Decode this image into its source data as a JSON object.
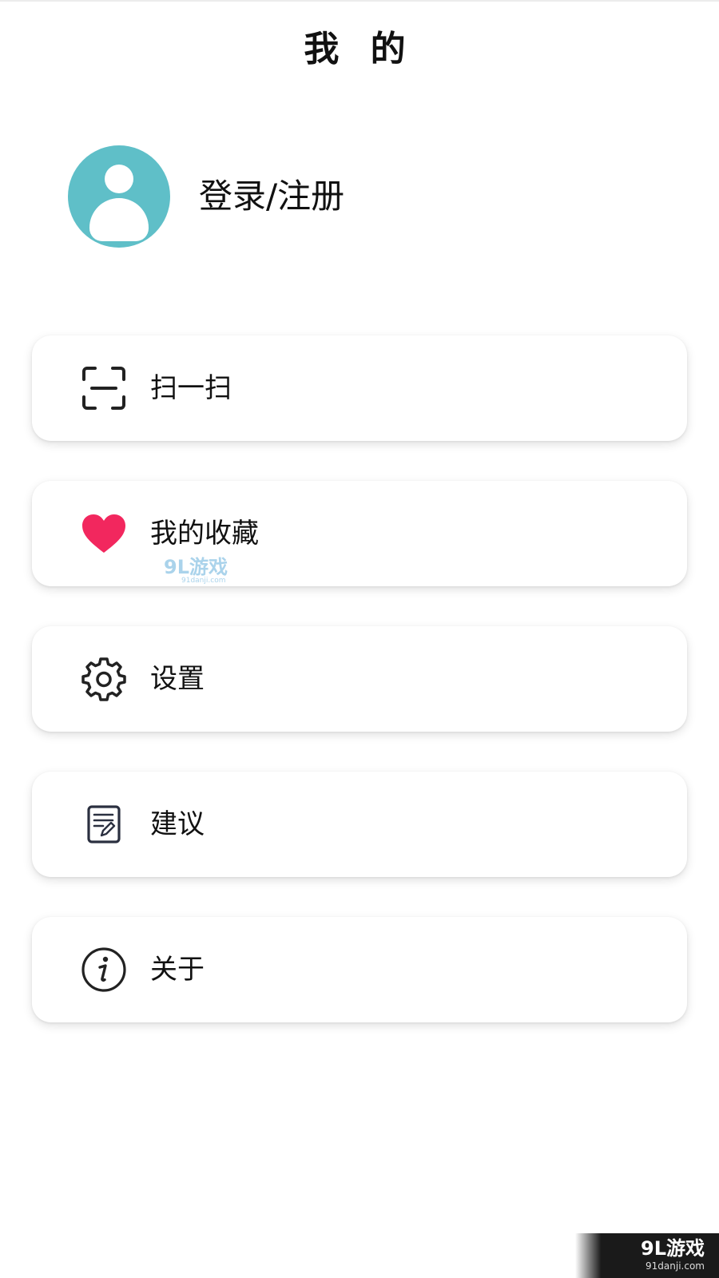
{
  "header": {
    "title": "我 的"
  },
  "profile": {
    "avatar_icon": "user-avatar-icon",
    "avatar_color": "#5fbfc8",
    "login_label": "登录/注册"
  },
  "menu": {
    "items": [
      {
        "label": "扫一扫",
        "icon": "scan-icon"
      },
      {
        "label": "我的收藏",
        "icon": "heart-icon",
        "icon_color": "#f2275e"
      },
      {
        "label": "设置",
        "icon": "gear-icon"
      },
      {
        "label": "建议",
        "icon": "feedback-note-icon"
      },
      {
        "label": "关于",
        "icon": "info-icon"
      }
    ]
  },
  "watermarks": {
    "middle_brand": "9L游戏",
    "middle_domain": "91danji.com",
    "corner_brand": "9L游戏",
    "corner_domain": "91danji.com"
  }
}
